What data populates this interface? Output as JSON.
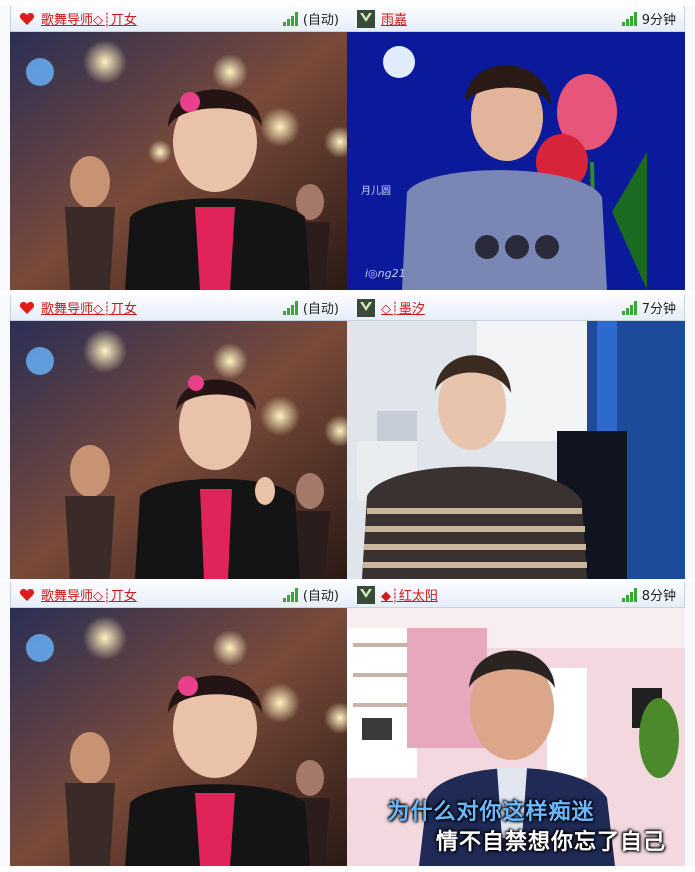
{
  "rows": [
    {
      "left": {
        "name": "歌舞导师◇┊丌女",
        "status": "(自动)"
      },
      "right": {
        "name": "雨嘉",
        "status": "9分钟",
        "overlay_caption": "月儿圆",
        "watermark": "i◎ng21"
      }
    },
    {
      "left": {
        "name": "歌舞导师◇┊丌女",
        "status": "(自动)"
      },
      "right": {
        "name": "◇┊墨汐",
        "status": "7分钟"
      }
    },
    {
      "left": {
        "name": "歌舞导师◇┊丌女",
        "status": "(自动)"
      },
      "right": {
        "name": "◆┊红太阳",
        "status": "8分钟",
        "lyrics": [
          "为什么对你这样痴迷",
          "情不自禁想你忘了自己"
        ]
      }
    }
  ],
  "icons": {
    "heart": "heart-icon",
    "signal": "signal-strength-icon",
    "avatar": "user-avatar-icon"
  },
  "colors": {
    "name_text": "#d01818",
    "heart": "#e11b1b",
    "signal": "#3aa637",
    "titlebar_bg": "#eef3fa"
  }
}
